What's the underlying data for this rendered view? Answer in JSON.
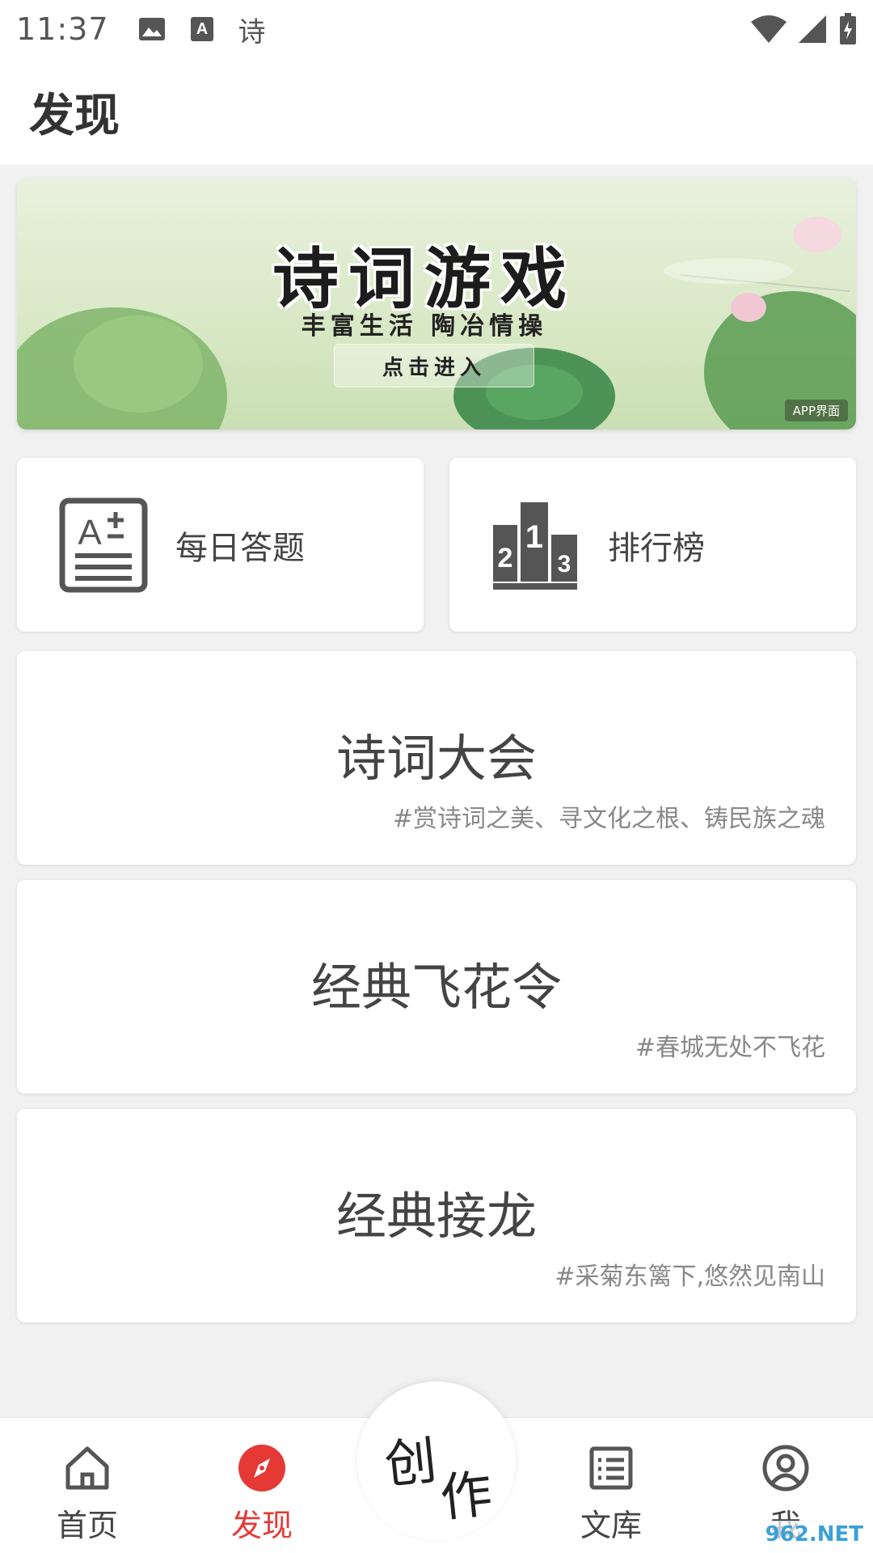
{
  "status_bar": {
    "time": "11:37",
    "notification_char": "诗",
    "icons": [
      "image-icon",
      "font-icon",
      "wifi-icon",
      "signal-icon",
      "battery-icon"
    ]
  },
  "header": {
    "title": "发现"
  },
  "banner": {
    "title": "诗词游戏",
    "subtitle": "丰富生活 陶冶情操",
    "button_label": "点击进入",
    "badge": "APP界面"
  },
  "quick_cards": [
    {
      "label": "每日答题",
      "icon": "quiz-icon"
    },
    {
      "label": "排行榜",
      "icon": "podium-icon"
    }
  ],
  "game_cards": [
    {
      "title": "诗词大会",
      "tag": "#赏诗词之美、寻文化之根、铸民族之魂"
    },
    {
      "title": "经典飞花令",
      "tag": "#春城无处不飞花"
    },
    {
      "title": "经典接龙",
      "tag": "#采菊东篱下,悠然见南山"
    }
  ],
  "bottom_nav": {
    "items": [
      {
        "label": "首页",
        "icon": "home-icon"
      },
      {
        "label": "发现",
        "icon": "compass-icon",
        "active": true
      },
      {
        "label": "文库",
        "icon": "list-icon"
      },
      {
        "label": "我",
        "icon": "user-icon"
      }
    ],
    "create_label_1": "创",
    "create_label_2": "作"
  },
  "watermark": "962.NET",
  "colors": {
    "accent": "#e53935",
    "background": "#f1f1f1",
    "card": "#ffffff"
  }
}
